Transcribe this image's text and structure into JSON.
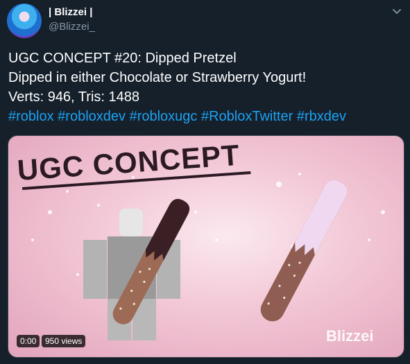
{
  "author": {
    "display_name": "| Blizzei |",
    "handle": "@Blizzei_"
  },
  "tweet": {
    "line1": "UGC CONCEPT #20: Dipped Pretzel",
    "line2": "Dipped in either Chocolate or Strawberry Yogurt!",
    "line3": "Verts: 946, Tris: 1488",
    "hashtags": [
      "#roblox",
      "#robloxdev",
      "#robloxugc",
      "#RobloxTwitter",
      "#rbxdev"
    ]
  },
  "media": {
    "banner_text": "UGC CONCEPT",
    "watermark": "Blizzei",
    "video_time": "0:00",
    "views": "950 views"
  },
  "icons": {
    "menu": "chevron-down-icon"
  },
  "colors": {
    "background": "#15202b",
    "hashtag": "#1da1f2",
    "secondary_text": "#8899a6"
  }
}
